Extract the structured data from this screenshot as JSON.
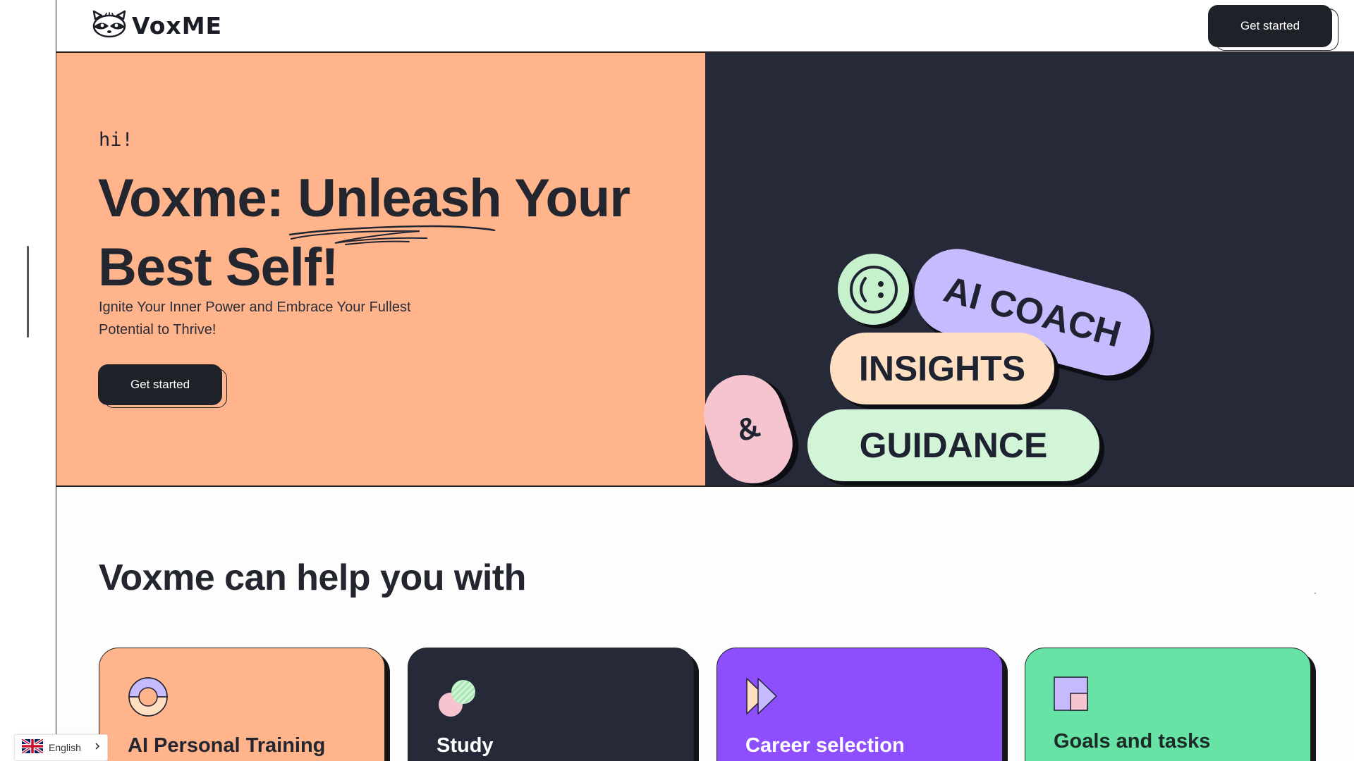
{
  "header": {
    "logo_text": "VoxME",
    "cta_label": "Get started"
  },
  "hero": {
    "greeting": "hi!",
    "title_part1": "Voxme: ",
    "title_emphasis": "Unleash",
    "title_part2": " Your Best Self!",
    "subtitle": "Ignite Your Inner Power and Embrace Your Fullest Potential to Thrive!",
    "cta_label": "Get started",
    "pills": {
      "ai_coach": "AI COACH",
      "insights": "INSIGHTS",
      "ampersand": "&",
      "guidance": "GUIDANCE"
    }
  },
  "services": {
    "title": "Voxme can help you with",
    "cards": [
      {
        "title": "AI Personal Training",
        "icon": "donut-icon"
      },
      {
        "title": "Study",
        "icon": "circles-icon"
      },
      {
        "title": "Career selection",
        "icon": "fast-forward-icon"
      },
      {
        "title": "Goals and tasks",
        "icon": "squares-icon"
      }
    ]
  },
  "language": {
    "label": "English",
    "flag": "uk-flag-icon"
  },
  "colors": {
    "peach": "#ffb48c",
    "navy": "#262a38",
    "purple": "#8d4ffe",
    "green": "#68e3a6",
    "lavender": "#c7bbff"
  }
}
